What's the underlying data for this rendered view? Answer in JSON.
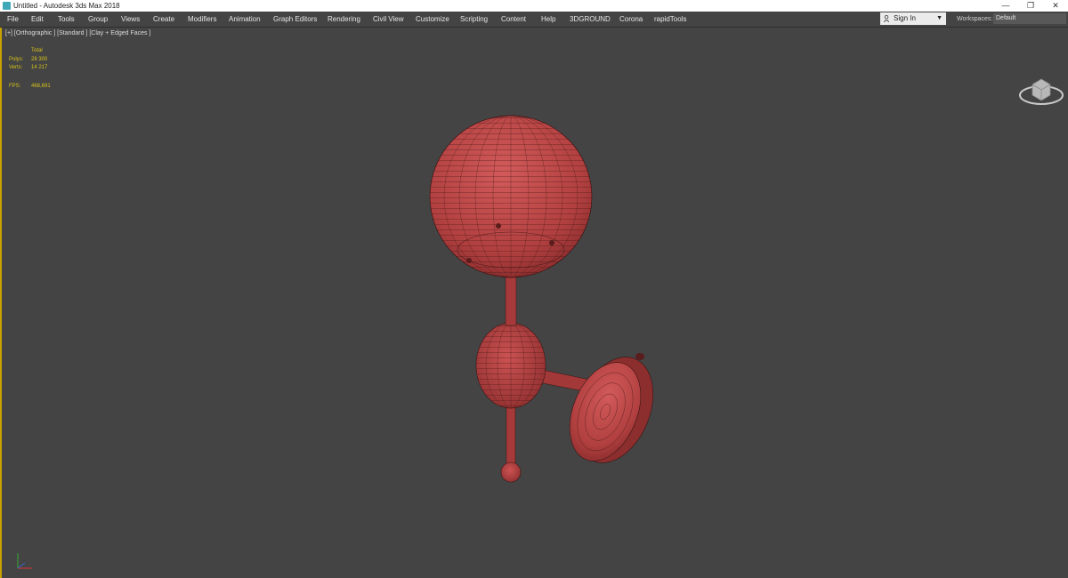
{
  "window": {
    "title": "Untitled - Autodesk 3ds Max 2018",
    "controls": [
      "—",
      "❐",
      "✕"
    ]
  },
  "menu": {
    "items": [
      "File",
      "Edit",
      "Tools",
      "Group",
      "Views",
      "Create",
      "Modifiers",
      "Animation",
      "Graph Editors",
      "Rendering",
      "Civil View",
      "Customize",
      "Scripting",
      "Content",
      "Help",
      "3DGROUND",
      "Corona",
      "rapidTools"
    ]
  },
  "account": {
    "sign_in": "Sign In",
    "workspaces_label": "Workspaces:",
    "workspace": "Default"
  },
  "viewport": {
    "label": "[+] [Orthographic ] [Standard ] [Clay + Edged Faces ]",
    "stats": {
      "header": "Total",
      "polys_label": "Polys:",
      "polys": "28 300",
      "verts_label": "Verts:",
      "verts": "14 217",
      "fps_label": "FPS:",
      "fps": "468,691"
    }
  },
  "colors": {
    "model": "#b84040",
    "wire": "#3a1414",
    "viewport_bg": "#444444",
    "active_border": "#c8a200"
  },
  "icons": {
    "app": "3dsmax-app-icon",
    "user": "user-icon",
    "viewcube": "viewcube-icon",
    "axis": "axis-tripod-icon"
  }
}
